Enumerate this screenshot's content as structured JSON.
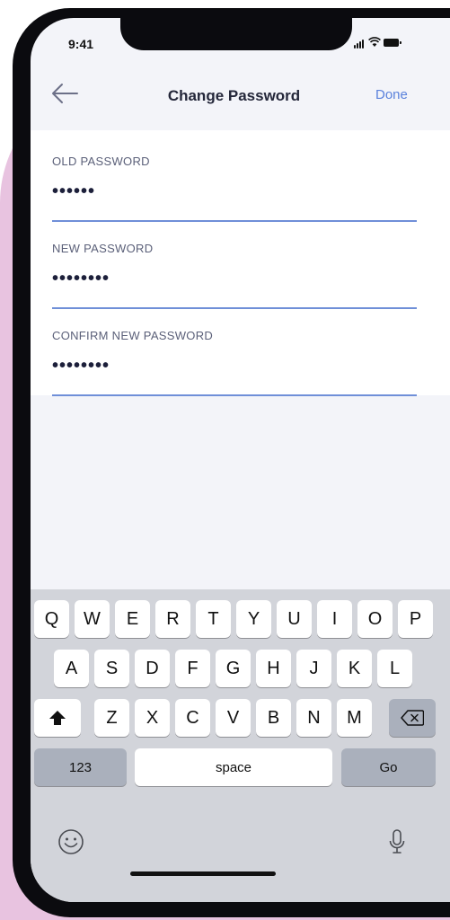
{
  "status_bar": {
    "time": "9:41",
    "signal_icon": "cellular-signal-icon",
    "wifi_icon": "wifi-icon",
    "battery_icon": "battery-icon"
  },
  "navbar": {
    "back_icon": "back-arrow-icon",
    "title": "Change Password",
    "done_label": "Done"
  },
  "form": {
    "fields": [
      {
        "label": "OLD PASSWORD",
        "value": "••••••"
      },
      {
        "label": "NEW PASSWORD",
        "value": "••••••••"
      },
      {
        "label": "CONFIRM NEW PASSWORD",
        "value": "••••••••"
      }
    ]
  },
  "keyboard": {
    "row1": [
      "Q",
      "W",
      "E",
      "R",
      "T",
      "Y",
      "U",
      "I",
      "O",
      "P"
    ],
    "row2": [
      "A",
      "S",
      "D",
      "F",
      "G",
      "H",
      "J",
      "K",
      "L"
    ],
    "row3": [
      "Z",
      "X",
      "C",
      "V",
      "B",
      "N",
      "M"
    ],
    "shift_icon": "shift-icon",
    "delete_icon": "delete-backspace-icon",
    "numbers_label": "123",
    "space_label": "space",
    "go_label": "Go",
    "emoji_icon": "emoji-icon",
    "mic_icon": "microphone-icon"
  },
  "colors": {
    "accent": "#5b82dc",
    "background_blob": "#e8c3e0",
    "input_underline": "#6f8fd8"
  }
}
